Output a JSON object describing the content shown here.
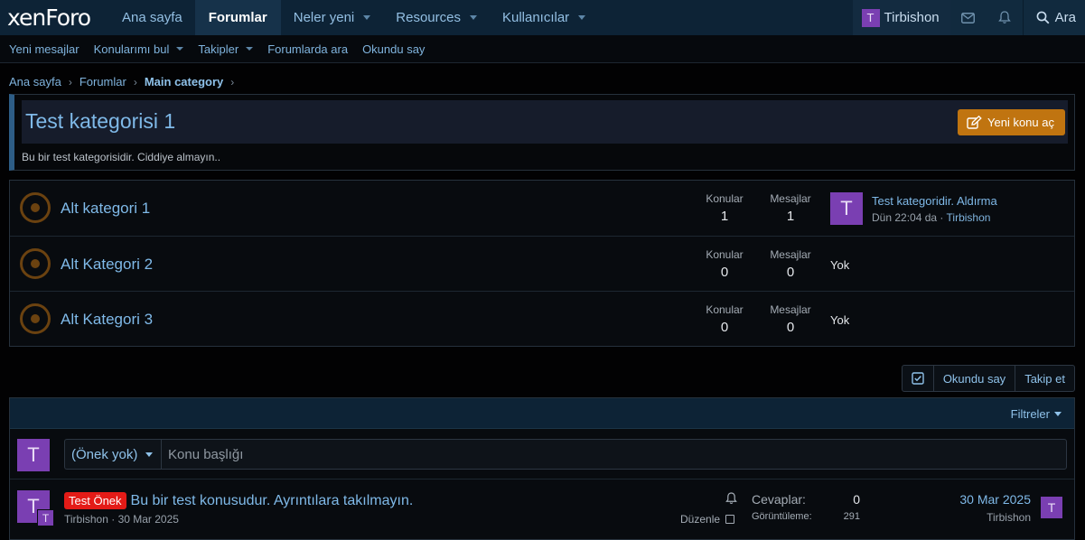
{
  "app": {
    "logo": "xenForo"
  },
  "nav": {
    "tabs": [
      {
        "label": "Ana sayfa"
      },
      {
        "label": "Forumlar"
      },
      {
        "label": "Neler yeni"
      },
      {
        "label": "Resources"
      },
      {
        "label": "Kullanıcılar"
      }
    ],
    "user": {
      "initial": "T",
      "name": "Tirbishon"
    },
    "search_label": "Ara"
  },
  "subnav": {
    "links": [
      {
        "label": "Yeni mesajlar"
      },
      {
        "label": "Konularımı bul"
      },
      {
        "label": "Takipler"
      },
      {
        "label": "Forumlarda ara"
      },
      {
        "label": "Okundu say"
      }
    ]
  },
  "breadcrumb": {
    "items": [
      "Ana sayfa",
      "Forumlar",
      "Main category"
    ]
  },
  "category": {
    "title": "Test kategorisi 1",
    "description": "Bu bir test kategorisidir. Ciddiye almayın..",
    "new_topic_label": "Yeni konu aç"
  },
  "stat_labels": {
    "topics": "Konular",
    "messages": "Mesajlar"
  },
  "nodes": [
    {
      "title": "Alt kategori 1",
      "topics": "1",
      "messages": "1",
      "last_title": "Test kategoridir. Aldırma",
      "last_time": "Dün 22:04 da",
      "last_sep": " · ",
      "last_user": "Tirbishon",
      "last_initial": "T"
    },
    {
      "title": "Alt Kategori 2",
      "topics": "0",
      "messages": "0",
      "none": "Yok"
    },
    {
      "title": "Alt Kategori 3",
      "topics": "0",
      "messages": "0",
      "none": "Yok"
    }
  ],
  "actions": {
    "mark_read": "Okundu say",
    "follow": "Takip et"
  },
  "threads": {
    "filters_label": "Filtreler",
    "quick": {
      "initial": "T",
      "prefix": "(Önek yok)",
      "placeholder": "Konu başlığı"
    },
    "items": [
      {
        "initial": "T",
        "prefix": "Test Önek",
        "title": "Bu bir test konusudur. Ayrıntılara takılmayın.",
        "meta": "Tirbishon · 30 Mar 2025",
        "edit_label": "Düzenle",
        "replies_label": "Cevaplar:",
        "replies": "0",
        "views_label": "Görüntüleme:",
        "views": "291",
        "last_date": "30 Mar 2025",
        "last_user": "Tirbishon"
      }
    ]
  },
  "colors": {
    "accent_link": "#7fb9e8",
    "nav_bg": "#0d2336",
    "button_orange": "#c07410",
    "avatar_purple": "#7a3fb2",
    "prefix_red": "#e41b17",
    "node_icon": "#6b4210"
  }
}
